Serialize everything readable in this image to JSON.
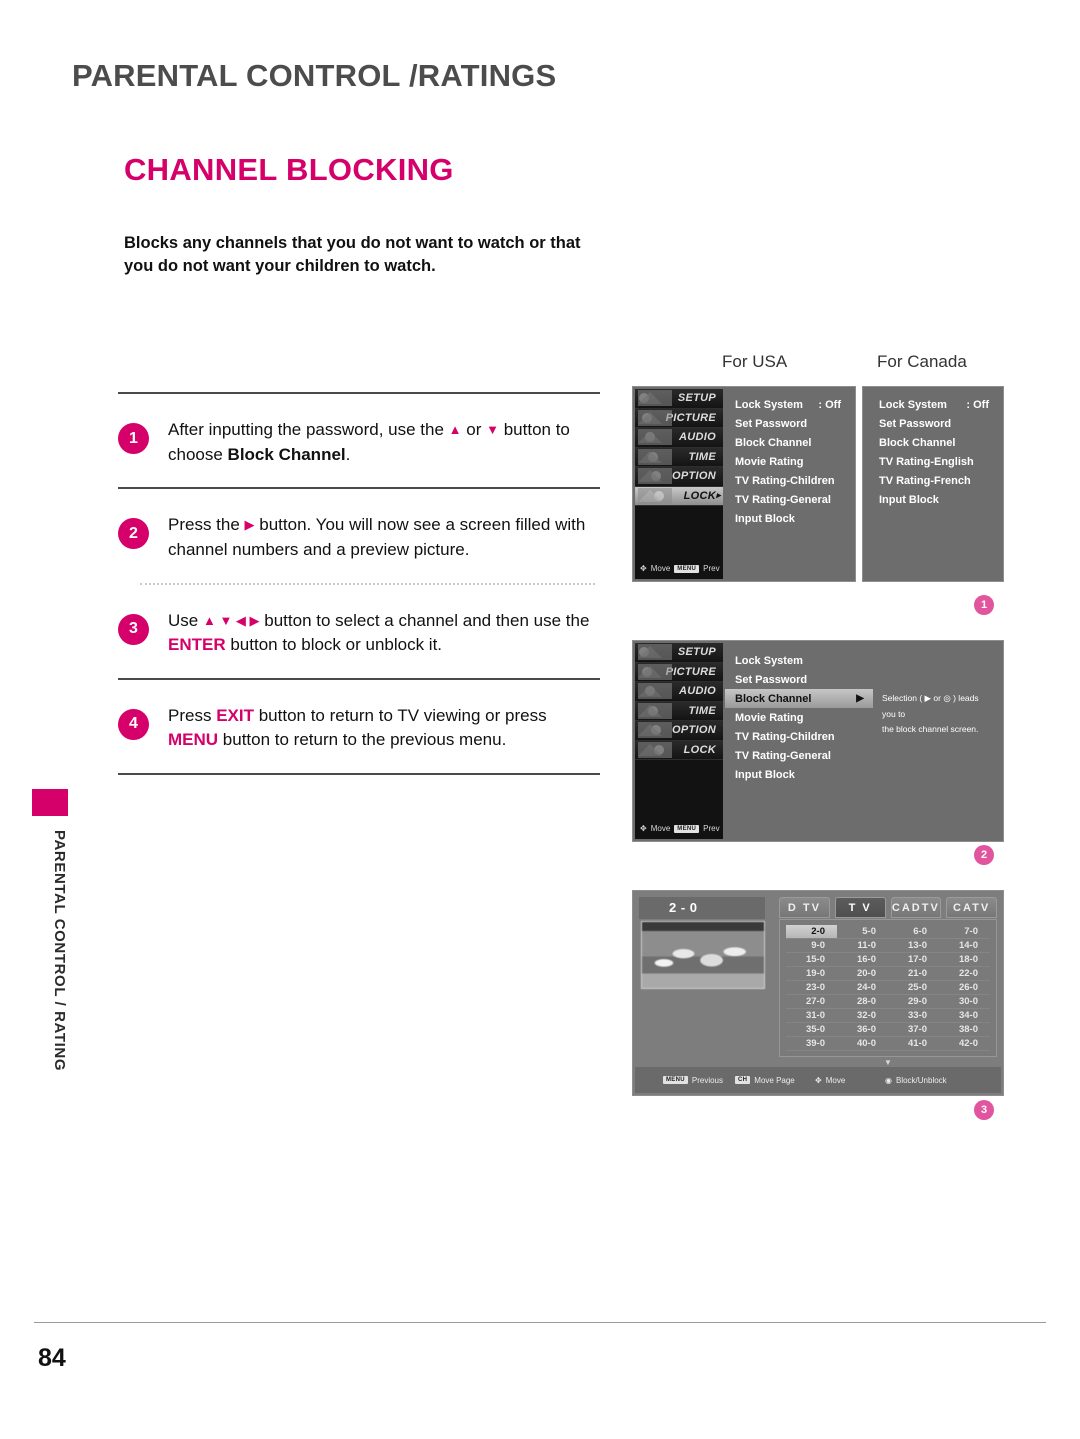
{
  "page": {
    "header_title": "PARENTAL CONTROL /RATINGS",
    "section_title": "CHANNEL BLOCKING",
    "intro": "Blocks any channels that you do not want to watch or that you do not want your children to watch.",
    "side_tab": "PARENTAL CONTROL / RATING",
    "page_number": "84",
    "accent_color": "#D6006B",
    "badge_color": "#E0559D"
  },
  "steps": [
    {
      "number": "1",
      "parts": [
        {
          "t": "After inputting the password, use the "
        },
        {
          "t": "▲",
          "style": "tri"
        },
        {
          "t": " or "
        },
        {
          "t": "▼",
          "style": "tri"
        },
        {
          "t": " button to choose "
        },
        {
          "t": "Block Channel",
          "style": "bold"
        },
        {
          "t": "."
        }
      ]
    },
    {
      "number": "2",
      "parts": [
        {
          "t": "Press the "
        },
        {
          "t": "▶",
          "style": "tri"
        },
        {
          "t": " button. You will now see a screen filled with channel numbers and a preview picture."
        }
      ]
    },
    {
      "number": "3",
      "parts": [
        {
          "t": "Use "
        },
        {
          "t": "▲ ▼ ◀ ▶",
          "style": "tri"
        },
        {
          "t": " button to select a channel and then use the "
        },
        {
          "t": "ENTER",
          "style": "kw"
        },
        {
          "t": " button to block or unblock it."
        }
      ]
    },
    {
      "number": "4",
      "parts": [
        {
          "t": "Press "
        },
        {
          "t": "EXIT",
          "style": "kw"
        },
        {
          "t": " button to return to TV viewing or press "
        },
        {
          "t": "MENU",
          "style": "kw"
        },
        {
          "t": " button to return to the previous menu."
        }
      ]
    }
  ],
  "figures": {
    "caption_usa": "For USA",
    "caption_canada": "For Canada",
    "marker_1": "1",
    "marker_2": "2",
    "marker_3": "3",
    "rail": {
      "items": [
        {
          "label": "SETUP",
          "selected": false
        },
        {
          "label": "PICTURE",
          "selected": false
        },
        {
          "label": "AUDIO",
          "selected": false
        },
        {
          "label": "TIME",
          "selected": false
        },
        {
          "label": "OPTION",
          "selected": false
        },
        {
          "label": "LOCK",
          "selected": true
        }
      ],
      "foot_move": "Move",
      "foot_menu_key": "MENU",
      "foot_prev": "Prev"
    },
    "rail2": {
      "items": [
        {
          "label": "SETUP",
          "selected": false
        },
        {
          "label": "PICTURE",
          "selected": false
        },
        {
          "label": "AUDIO",
          "selected": false
        },
        {
          "label": "TIME",
          "selected": false
        },
        {
          "label": "OPTION",
          "selected": false
        },
        {
          "label": "LOCK",
          "selected": false
        }
      ]
    },
    "usa_menu": [
      {
        "label": "Lock System",
        "value": ": Off"
      },
      {
        "label": "Set Password",
        "value": ""
      },
      {
        "label": "Block Channel",
        "value": ""
      },
      {
        "label": "Movie Rating",
        "value": ""
      },
      {
        "label": "TV Rating-Children",
        "value": ""
      },
      {
        "label": "TV Rating-General",
        "value": ""
      },
      {
        "label": "Input Block",
        "value": ""
      }
    ],
    "canada_menu": [
      {
        "label": "Lock System",
        "value": ": Off"
      },
      {
        "label": "Set Password",
        "value": ""
      },
      {
        "label": "Block Channel",
        "value": ""
      },
      {
        "label": "TV Rating-English",
        "value": ""
      },
      {
        "label": "TV Rating-French",
        "value": ""
      },
      {
        "label": "Input Block",
        "value": ""
      }
    ],
    "step2_menu": [
      {
        "label": "Lock System",
        "highlighted": false,
        "arrow": ""
      },
      {
        "label": "Set Password",
        "highlighted": false,
        "arrow": ""
      },
      {
        "label": "Block Channel",
        "highlighted": true,
        "arrow": "▶"
      },
      {
        "label": "Movie Rating",
        "highlighted": false,
        "arrow": ""
      },
      {
        "label": "TV Rating-Children",
        "highlighted": false,
        "arrow": ""
      },
      {
        "label": "TV Rating-General",
        "highlighted": false,
        "arrow": ""
      },
      {
        "label": "Input Block",
        "highlighted": false,
        "arrow": ""
      }
    ],
    "step2_help_line1": "Selection ( ▶ or ◎ ) leads you to",
    "step2_help_line2": "the block channel screen.",
    "channel_screen": {
      "preview_label": "2 - 0",
      "tabs": [
        {
          "label": "D TV",
          "selected": false
        },
        {
          "label": "T V",
          "selected": true
        },
        {
          "label": "CADTV",
          "selected": false
        },
        {
          "label": "CATV",
          "selected": false
        }
      ],
      "grid_rows": [
        [
          "2-0",
          "5-0",
          "6-0",
          "7-0"
        ],
        [
          "9-0",
          "11-0",
          "13-0",
          "14-0"
        ],
        [
          "15-0",
          "16-0",
          "17-0",
          "18-0"
        ],
        [
          "19-0",
          "20-0",
          "21-0",
          "22-0"
        ],
        [
          "23-0",
          "24-0",
          "25-0",
          "26-0"
        ],
        [
          "27-0",
          "28-0",
          "29-0",
          "30-0"
        ],
        [
          "31-0",
          "32-0",
          "33-0",
          "34-0"
        ],
        [
          "35-0",
          "36-0",
          "37-0",
          "38-0"
        ],
        [
          "39-0",
          "40-0",
          "41-0",
          "42-0"
        ]
      ],
      "selected_channel": "2-0",
      "more_indicator": "▼",
      "footer": [
        {
          "key": "MENU",
          "label": "Previous"
        },
        {
          "key": "CH",
          "label": "Move Page"
        },
        {
          "key": "✥",
          "label": "Move"
        },
        {
          "key": "◉",
          "label": "Block/Unblock"
        }
      ]
    }
  }
}
